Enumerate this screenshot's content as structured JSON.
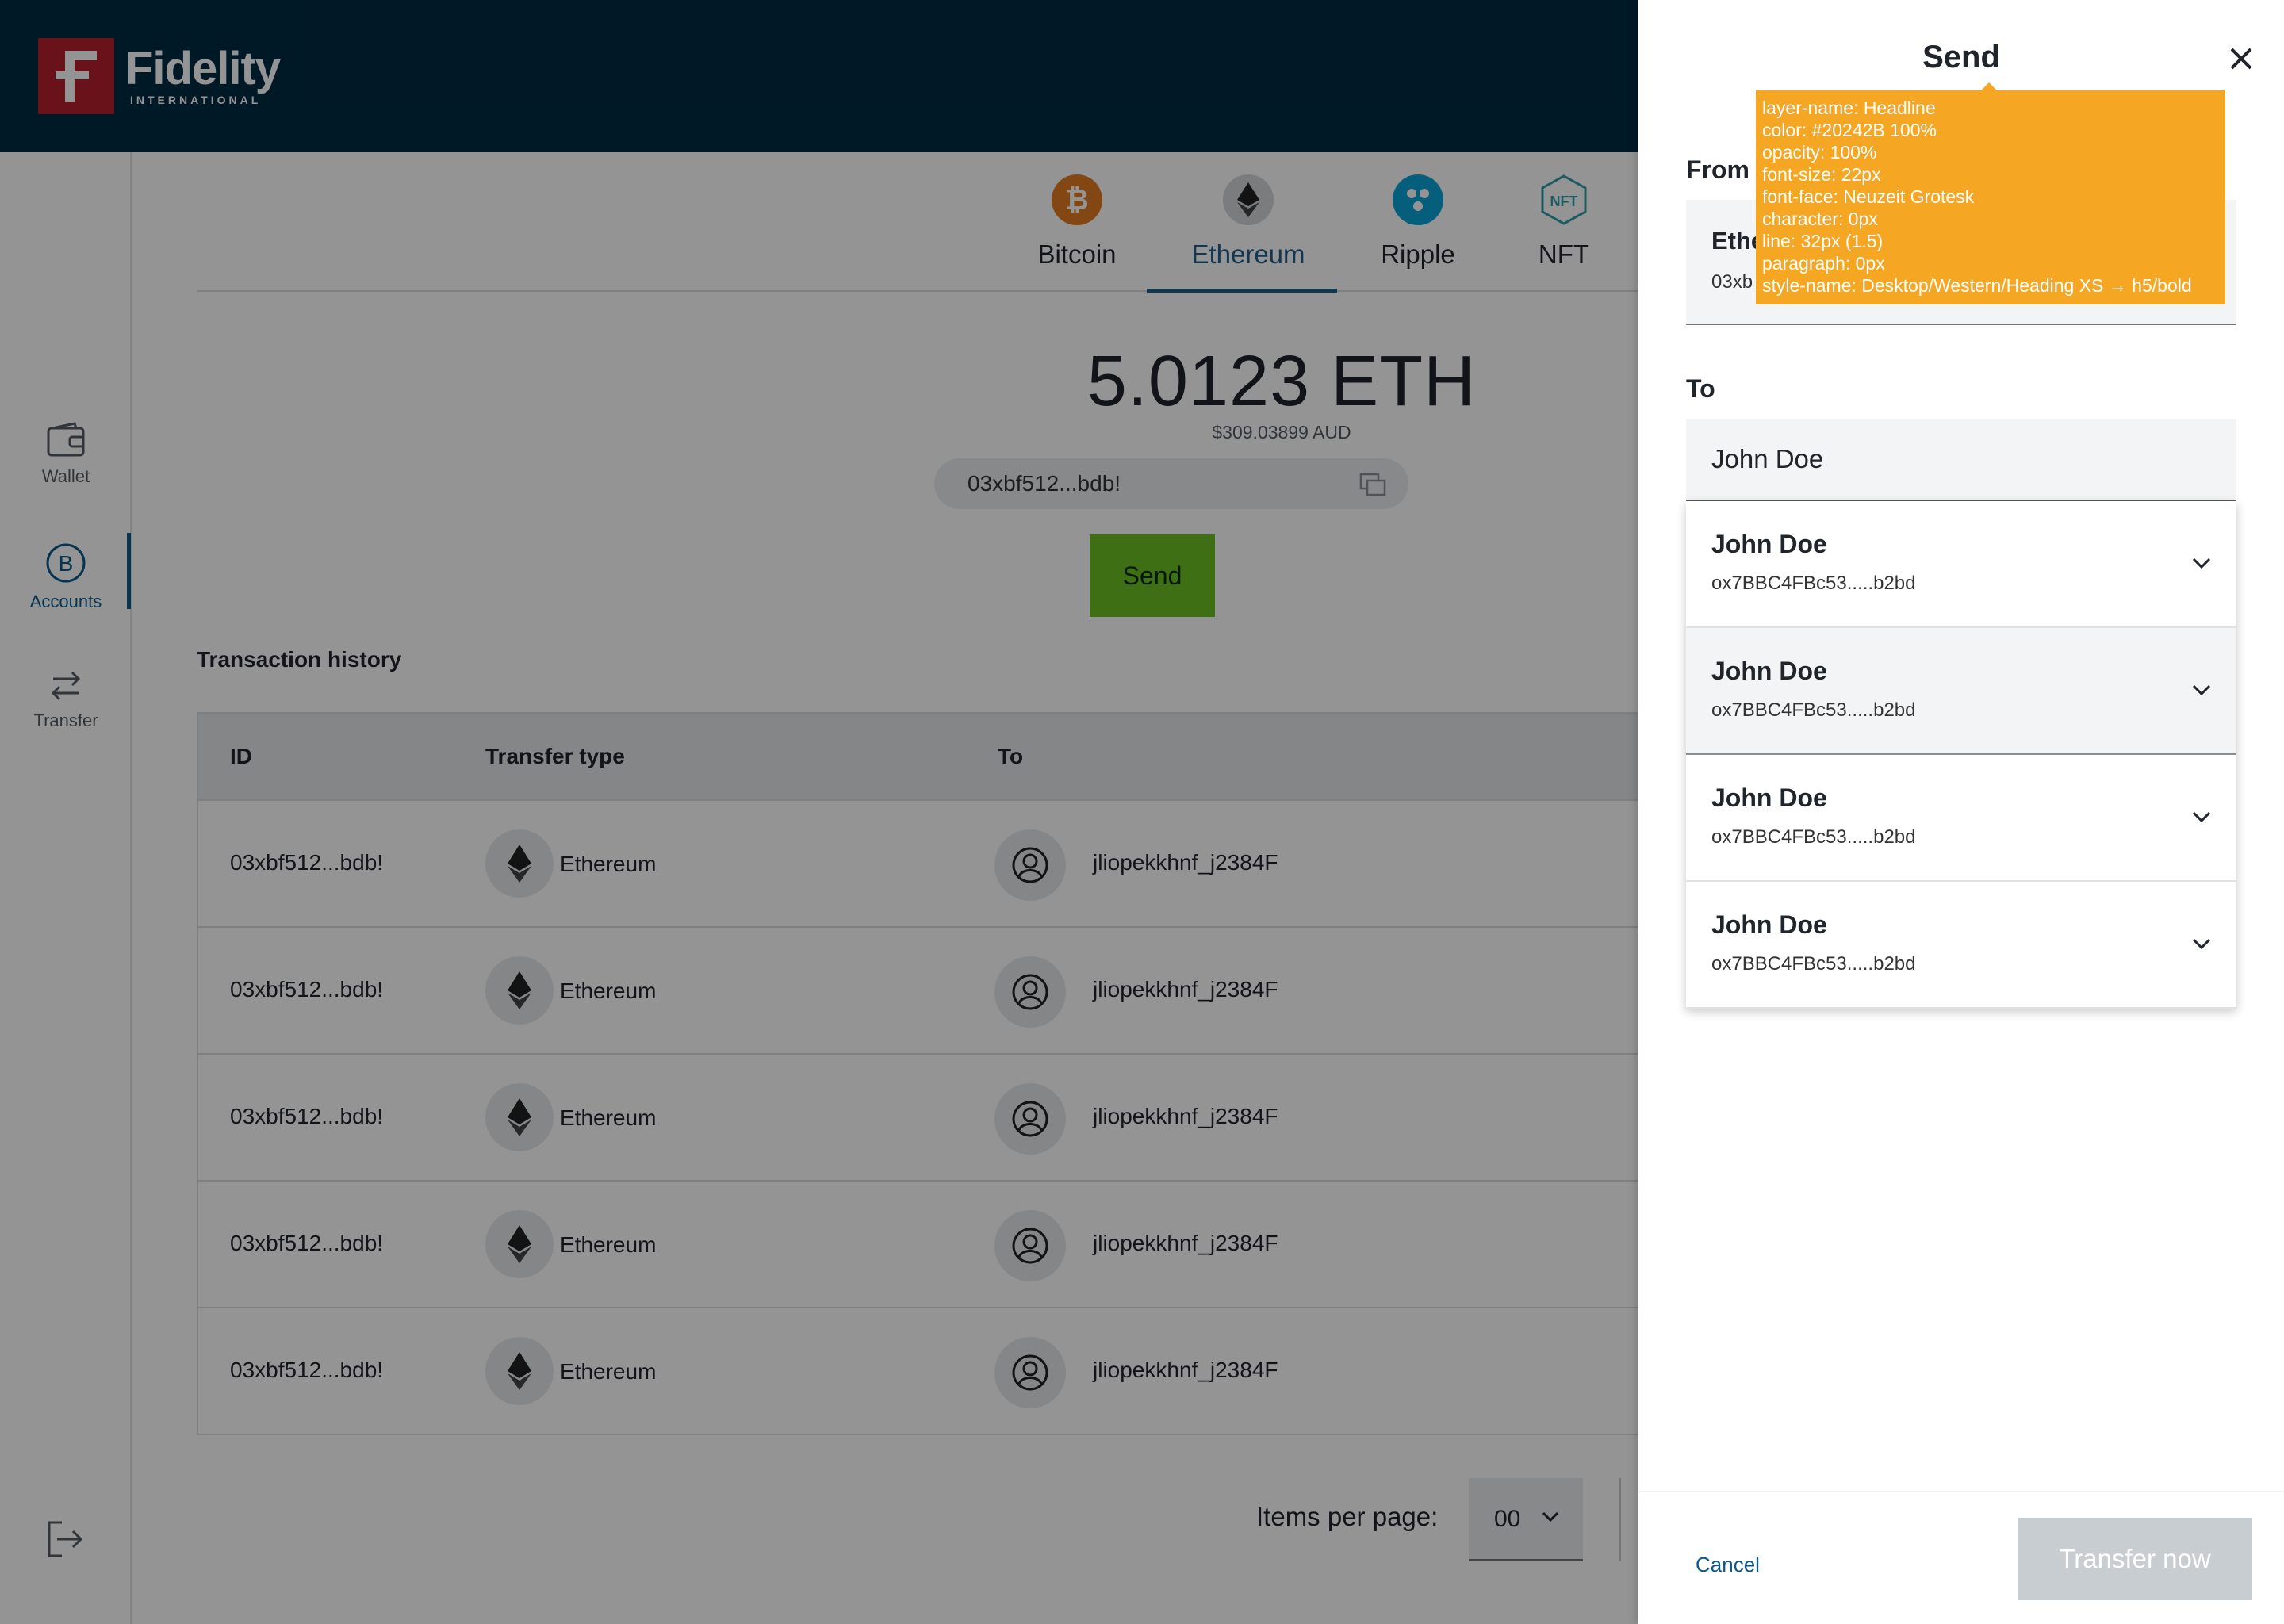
{
  "brand": {
    "name": "Fidelity",
    "sub": "INTERNATIONAL"
  },
  "nav": [
    {
      "label": "Wallet",
      "icon": "wallet-icon"
    },
    {
      "label": "Accounts",
      "icon": "bitcoin-circle-icon",
      "active": true
    },
    {
      "label": "Transfer",
      "icon": "transfer-arrows-icon"
    }
  ],
  "tabs": [
    {
      "label": "Bitcoin",
      "icon": "bitcoin-icon",
      "color": "#e07a1f"
    },
    {
      "label": "Ethereum",
      "icon": "ethereum-icon",
      "color": "#b0b5ba",
      "active": true
    },
    {
      "label": "Ripple",
      "icon": "ripple-icon",
      "color": "#0aa2d6"
    },
    {
      "label": "NFT",
      "icon": "nft-icon",
      "color": "#2f9ea6"
    }
  ],
  "account": {
    "balance": "5.0123 ETH",
    "fiat": "$309.03899 AUD",
    "address": "03xbf512...bdb!",
    "send_label": "Send"
  },
  "history": {
    "title": "Transaction history",
    "columns": [
      "ID",
      "Transfer type",
      "To"
    ],
    "rows": [
      {
        "id": "03xbf512...bdb!",
        "type": "Ethereum",
        "to": "jliopekkhnf_j2384F"
      },
      {
        "id": "03xbf512...bdb!",
        "type": "Ethereum",
        "to": "jliopekkhnf_j2384F"
      },
      {
        "id": "03xbf512...bdb!",
        "type": "Ethereum",
        "to": "jliopekkhnf_j2384F"
      },
      {
        "id": "03xbf512...bdb!",
        "type": "Ethereum",
        "to": "jliopekkhnf_j2384F"
      },
      {
        "id": "03xbf512...bdb!",
        "type": "Ethereum",
        "to": "jliopekkhnf_j2384F"
      }
    ]
  },
  "pager": {
    "label": "Items per page:",
    "value": "00"
  },
  "drawer": {
    "title": "Send",
    "from_label": "From",
    "from_name": "Ethe",
    "from_addr": "03xb",
    "to_label": "To",
    "to_value": "John Doe",
    "suggestions": [
      {
        "name": "John Doe",
        "addr": "ox7BBC4FBc53.....b2bd"
      },
      {
        "name": "John Doe",
        "addr": "ox7BBC4FBc53.....b2bd"
      },
      {
        "name": "John Doe",
        "addr": "ox7BBC4FBc53.....b2bd"
      },
      {
        "name": "John Doe",
        "addr": "ox7BBC4FBc53.....b2bd"
      }
    ],
    "cancel_label": "Cancel",
    "transfer_label": "Transfer now"
  },
  "tooltip": [
    "layer-name: Headline",
    "color: #20242B 100%",
    "opacity: 100%",
    "font-size: 22px",
    "font-face: Neuzeit Grotesk",
    "character: 0px",
    "line: 32px (1.5)",
    "paragraph: 0px",
    "style-name: Desktop/Western/Heading XS → h5/bold"
  ],
  "colors": {
    "header": "#012b44",
    "accent": "#0d5a8a",
    "send": "#6cc024",
    "tooltip": "#f5a623"
  }
}
